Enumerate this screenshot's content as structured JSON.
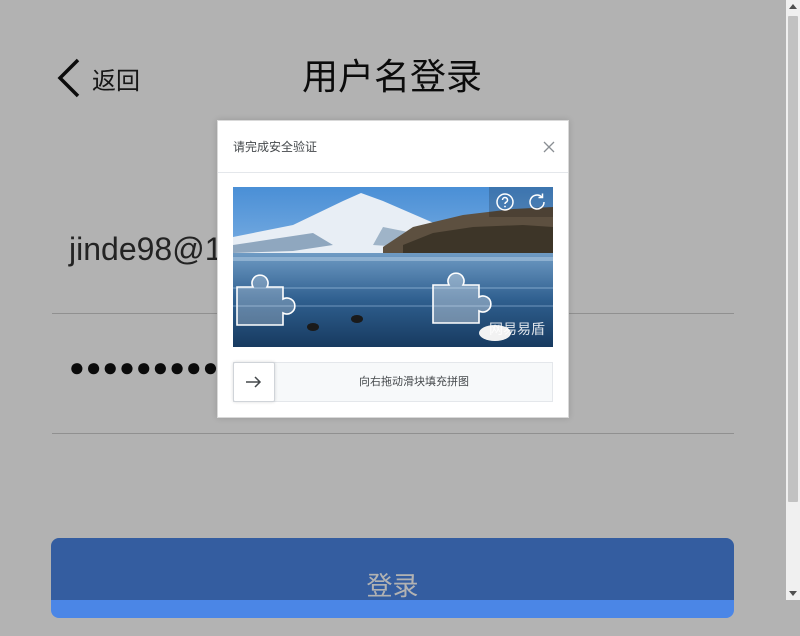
{
  "header": {
    "back_label": "返回",
    "title": "用户名登录"
  },
  "form": {
    "email_value": "jinde98@1",
    "password_value": "●●●●●●●●●●",
    "login_label": "登录"
  },
  "captcha": {
    "title": "请完成安全验证",
    "slider_hint": "向右拖动滑块填充拼图",
    "watermark": "网易易盾",
    "icons": {
      "close": "close-icon",
      "help": "help-icon",
      "refresh": "refresh-icon",
      "slider": "arrow-right-icon"
    }
  },
  "colors": {
    "login_button": "#4b86e6",
    "overlay": "rgba(0,0,0,0.3)"
  }
}
